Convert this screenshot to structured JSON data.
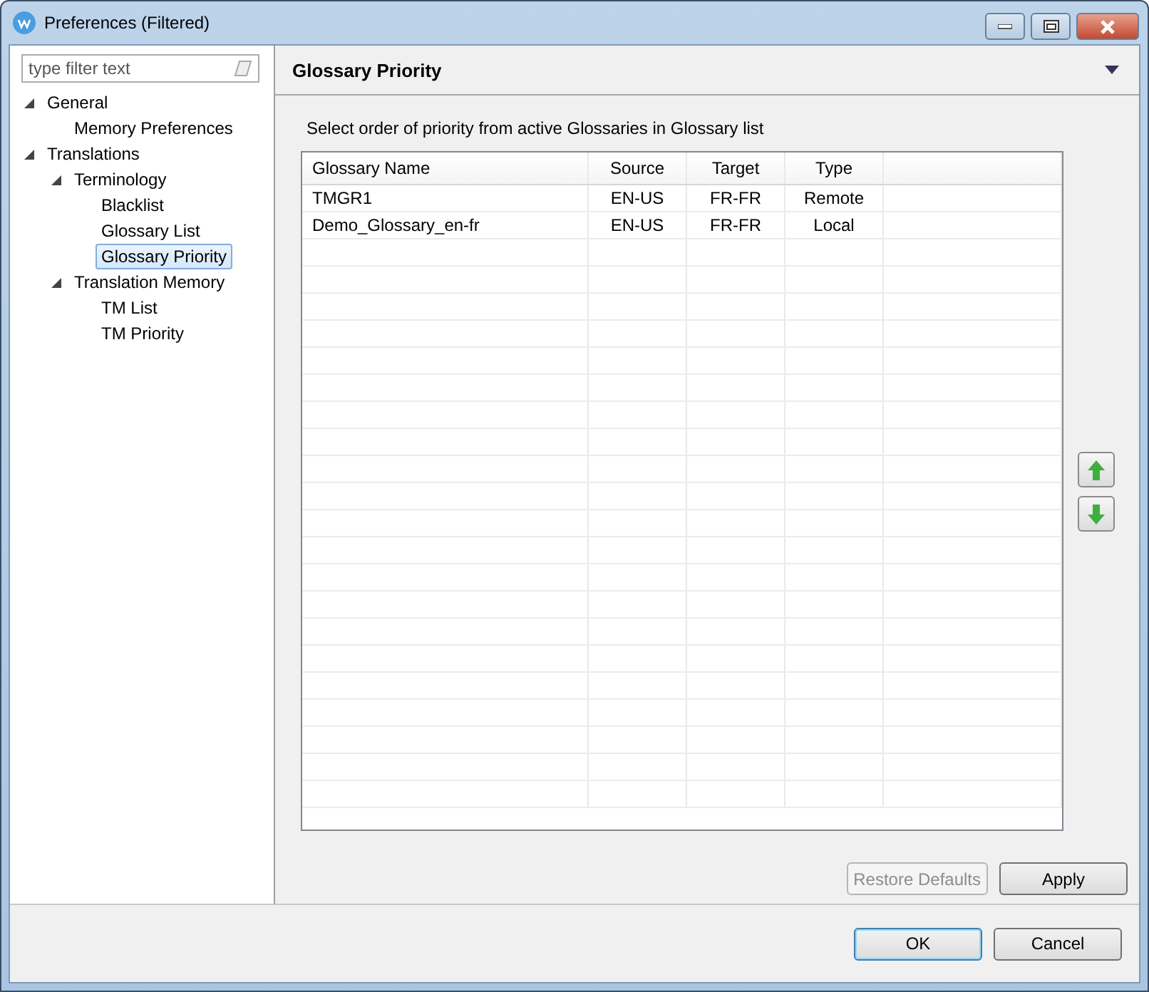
{
  "window": {
    "title": "Preferences (Filtered)"
  },
  "filter": {
    "placeholder": "type filter text"
  },
  "tree": [
    {
      "label": "General",
      "expanded": true,
      "selected": false,
      "children": [
        {
          "label": "Memory Preferences",
          "selected": false
        }
      ]
    },
    {
      "label": "Translations",
      "expanded": true,
      "selected": false,
      "children": [
        {
          "label": "Terminology",
          "expanded": true,
          "selected": false,
          "children": [
            {
              "label": "Blacklist",
              "selected": false
            },
            {
              "label": "Glossary List",
              "selected": false
            },
            {
              "label": "Glossary Priority",
              "selected": true
            }
          ]
        },
        {
          "label": "Translation Memory",
          "expanded": true,
          "selected": false,
          "children": [
            {
              "label": "TM List",
              "selected": false
            },
            {
              "label": "TM Priority",
              "selected": false
            }
          ]
        }
      ]
    }
  ],
  "page": {
    "title": "Glossary Priority",
    "description": "Select order of priority from active Glossaries in Glossary list"
  },
  "table": {
    "columns": [
      "Glossary Name",
      "Source",
      "Target",
      "Type"
    ],
    "rows": [
      [
        "TMGR1",
        "EN-US",
        "FR-FR",
        "Remote"
      ],
      [
        "Demo_Glossary_en-fr",
        "EN-US",
        "FR-FR",
        "Local"
      ]
    ]
  },
  "page_buttons": [
    {
      "label": "Restore Defaults",
      "disabled": true
    },
    {
      "label": "Apply",
      "disabled": false
    }
  ],
  "dialog_buttons": [
    {
      "label": "OK",
      "default": true
    },
    {
      "label": "Cancel",
      "default": false
    }
  ]
}
